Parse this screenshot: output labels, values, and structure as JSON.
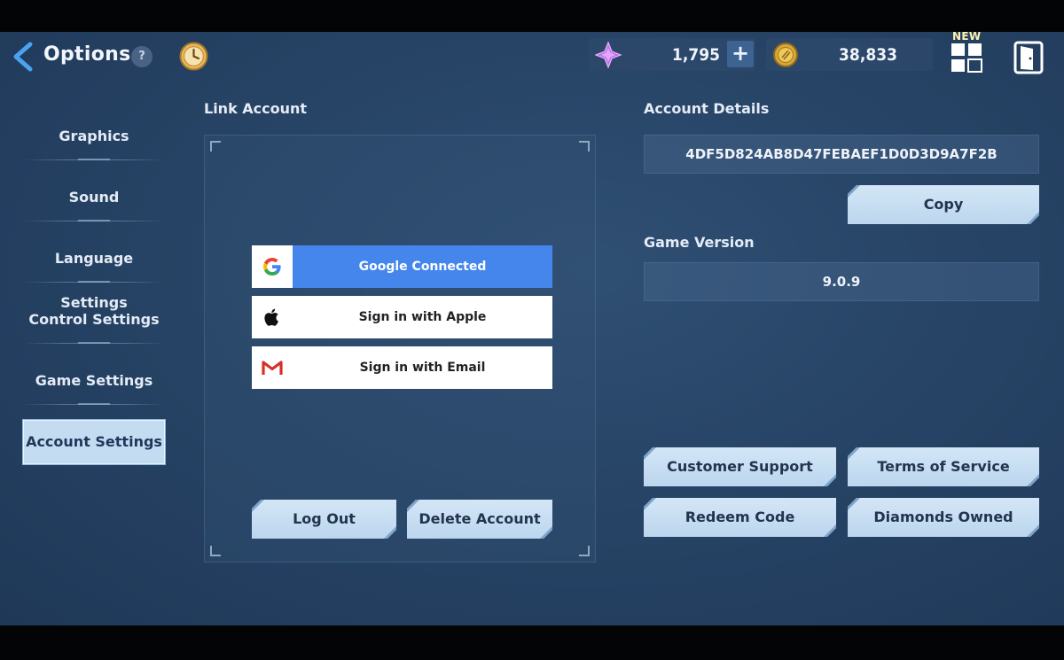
{
  "header": {
    "title": "Options",
    "help": "?",
    "gems": "1,795",
    "plus": "+",
    "gold": "38,833",
    "new_badge": "NEW",
    "icons": [
      "back-arrow-icon",
      "question-icon",
      "clock-icon",
      "gem-icon",
      "plus-icon",
      "gold-coin-icon",
      "grid-icon",
      "exit-door-icon"
    ]
  },
  "sidebar": {
    "items": [
      {
        "label": "Graphics"
      },
      {
        "label": "Sound"
      },
      {
        "label": "Language Settings"
      },
      {
        "label": "Control Settings"
      },
      {
        "label": "Game Settings"
      },
      {
        "label": "Account Settings"
      }
    ],
    "active": "Account Settings"
  },
  "link_account": {
    "title": "Link Account",
    "google": "Google Connected",
    "apple": "Sign in with Apple",
    "email": "Sign in with Email",
    "logout": "Log Out",
    "delete": "Delete Account"
  },
  "account_details": {
    "title": "Account Details",
    "id": "4DF5D824AB8D47FEBAEF1D0D3D9A7F2B",
    "copy": "Copy",
    "version_title": "Game Version",
    "version": "9.0.9"
  },
  "actions": {
    "support": "Customer Support",
    "terms": "Terms of Service",
    "redeem": "Redeem Code",
    "diamonds": "Diamonds Owned"
  },
  "colors": {
    "background": "#274466",
    "accent_light": "#c4dcf2",
    "google_blue": "#4486ec",
    "gmail_red": "#d93025"
  }
}
